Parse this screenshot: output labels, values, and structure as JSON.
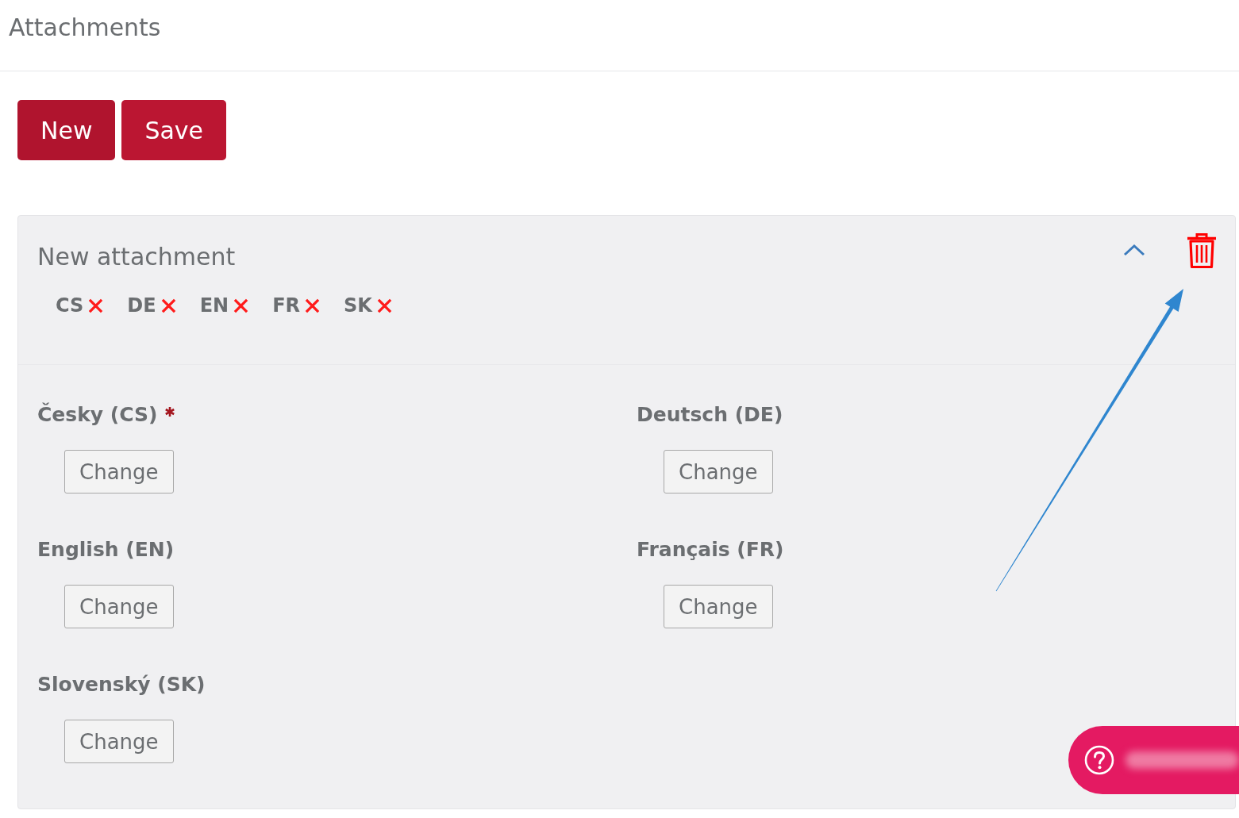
{
  "page": {
    "title": "Attachments"
  },
  "toolbar": {
    "buttons": [
      "New",
      "Save"
    ]
  },
  "attachment": {
    "title": "New attachment",
    "expanded": true,
    "languages": [
      {
        "code": "CS",
        "uploaded": false
      },
      {
        "code": "DE",
        "uploaded": false
      },
      {
        "code": "EN",
        "uploaded": false
      },
      {
        "code": "FR",
        "uploaded": false
      },
      {
        "code": "SK",
        "uploaded": false
      }
    ],
    "fields": [
      {
        "label": "Česky (CS)",
        "required": true,
        "button": "Change"
      },
      {
        "label": "Deutsch (DE)",
        "required": false,
        "button": "Change"
      },
      {
        "label": "English (EN)",
        "required": false,
        "button": "Change"
      },
      {
        "label": "Français (FR)",
        "required": false,
        "button": "Change"
      },
      {
        "label": "Slovenský (SK)",
        "required": false,
        "button": "Change"
      }
    ]
  }
}
